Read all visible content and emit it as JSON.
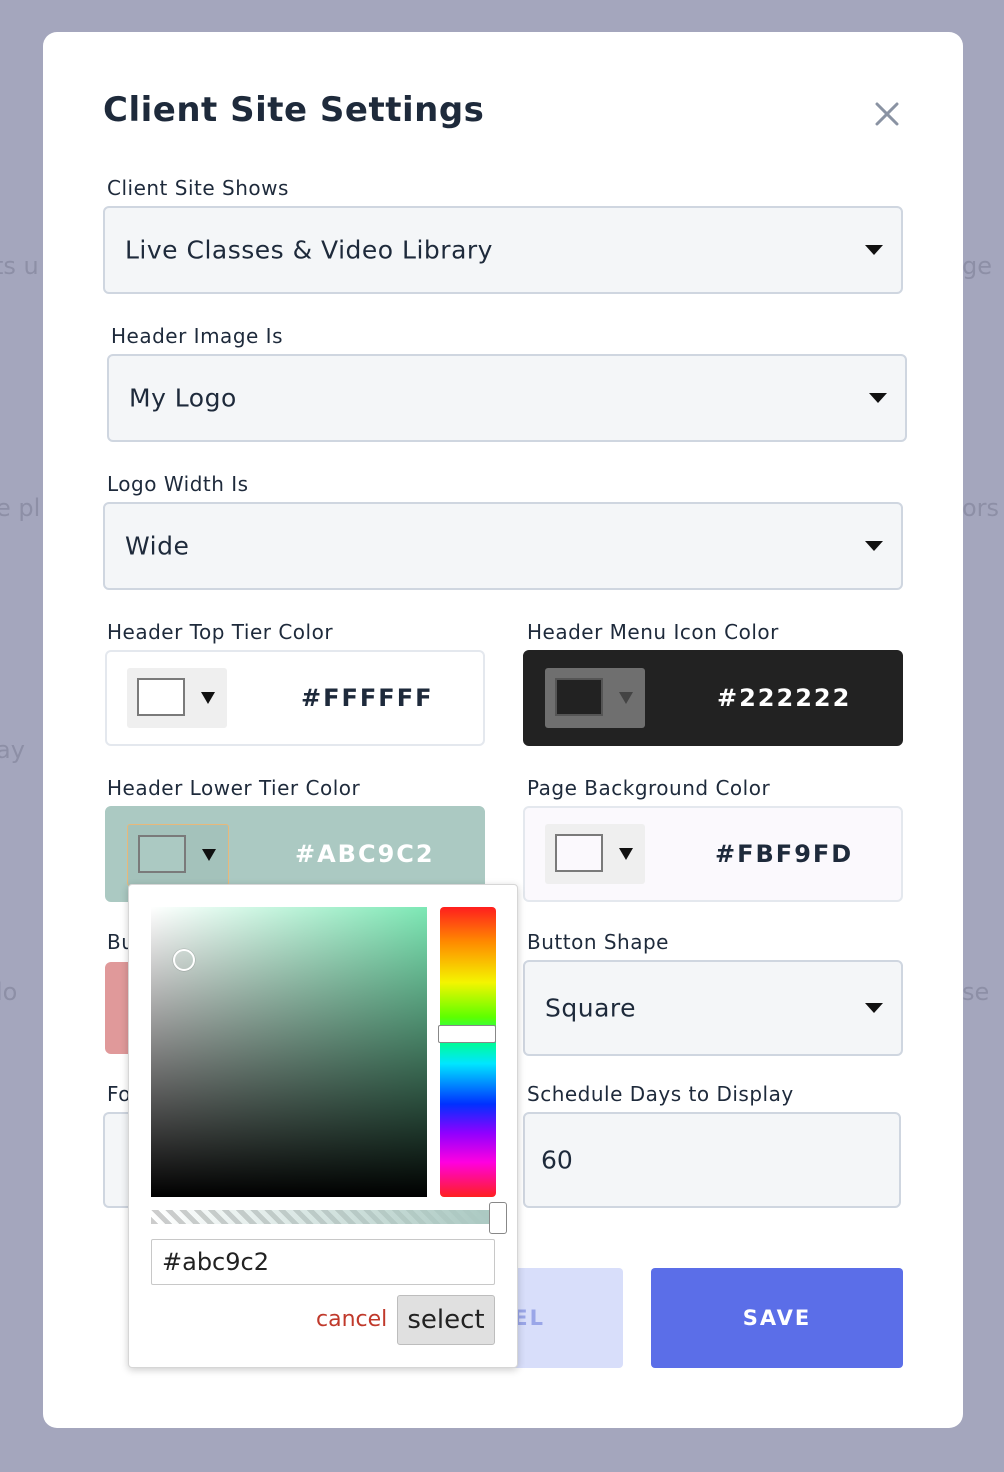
{
  "modal": {
    "title": "Client Site Settings"
  },
  "fields": {
    "client_site_shows": {
      "label": "Client Site Shows",
      "value": "Live Classes & Video Library"
    },
    "header_image": {
      "label": "Header Image Is",
      "value": "My Logo"
    },
    "logo_width": {
      "label": "Logo Width Is",
      "value": "Wide"
    },
    "header_top_tier_color": {
      "label": "Header Top Tier Color",
      "value": "#FFFFFF"
    },
    "header_menu_icon_color": {
      "label": "Header Menu Icon Color",
      "value": "#222222"
    },
    "header_lower_tier_color": {
      "label": "Header Lower Tier Color",
      "value": "#ABC9C2"
    },
    "page_background_color": {
      "label": "Page Background Color",
      "value": "#FBF9FD"
    },
    "button_color": {
      "label_partial": "Bu"
    },
    "button_shape": {
      "label": "Button Shape",
      "value": "Square"
    },
    "font": {
      "label_partial": "Fo"
    },
    "schedule_days": {
      "label": "Schedule Days to Display",
      "value": "60"
    }
  },
  "buttons": {
    "cancel_partial": "EL",
    "save": "SAVE"
  },
  "color_picker": {
    "hex_value": "#abc9c2",
    "cancel_label": "cancel",
    "select_label": "select"
  },
  "colors": {
    "save_button": "#5b6ee8",
    "cancel_button": "#d8defa",
    "lower_tier": "#abc9c2",
    "menu_icon": "#222222",
    "button_color_swatch": "#e0999a"
  }
}
